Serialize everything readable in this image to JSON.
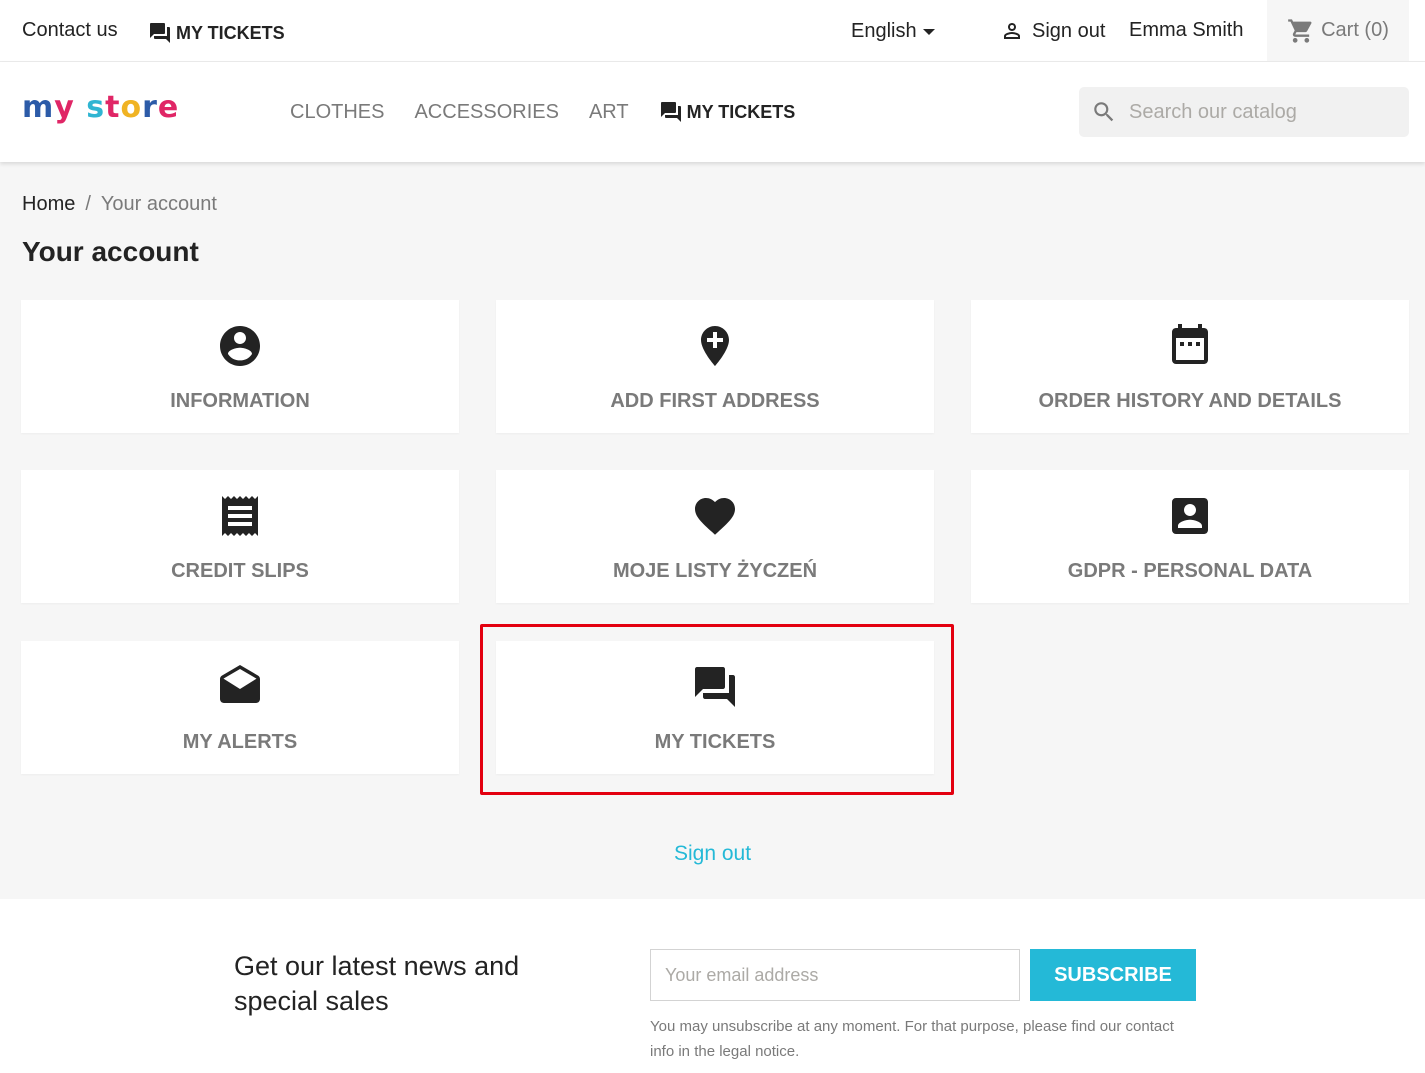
{
  "topbar": {
    "contact": "Contact us",
    "tickets": "MY TICKETS",
    "language": "English",
    "signout": "Sign out",
    "username": "Emma Smith",
    "cart": "Cart (0)"
  },
  "header": {
    "nav": [
      "CLOTHES",
      "ACCESSORIES",
      "ART",
      "MY TICKETS"
    ],
    "search_placeholder": "Search our catalog"
  },
  "breadcrumb": {
    "home": "Home",
    "sep": "/",
    "current": "Your account"
  },
  "page_title": "Your account",
  "cards": [
    {
      "label": "INFORMATION",
      "icon": "account-circle-icon"
    },
    {
      "label": "ADD FIRST ADDRESS",
      "icon": "add-location-icon"
    },
    {
      "label": "ORDER HISTORY AND DETAILS",
      "icon": "calendar-icon"
    },
    {
      "label": "CREDIT SLIPS",
      "icon": "receipt-icon"
    },
    {
      "label": "MOJE LISTY ŻYCZEŃ",
      "icon": "heart-icon"
    },
    {
      "label": "GDPR - PERSONAL DATA",
      "icon": "account-box-icon"
    },
    {
      "label": "MY ALERTS",
      "icon": "drafts-icon"
    },
    {
      "label": "MY TICKETS",
      "icon": "forum-icon"
    }
  ],
  "signout_link": "Sign out",
  "newsletter": {
    "title": "Get our latest news and special sales",
    "email_placeholder": "Your email address",
    "subscribe": "SUBSCRIBE",
    "disclaimer": "You may unsubscribe at any moment. For that purpose, please find our contact info in the legal notice."
  },
  "colors": {
    "accent": "#24b9d7",
    "highlight": "#e3000f"
  }
}
